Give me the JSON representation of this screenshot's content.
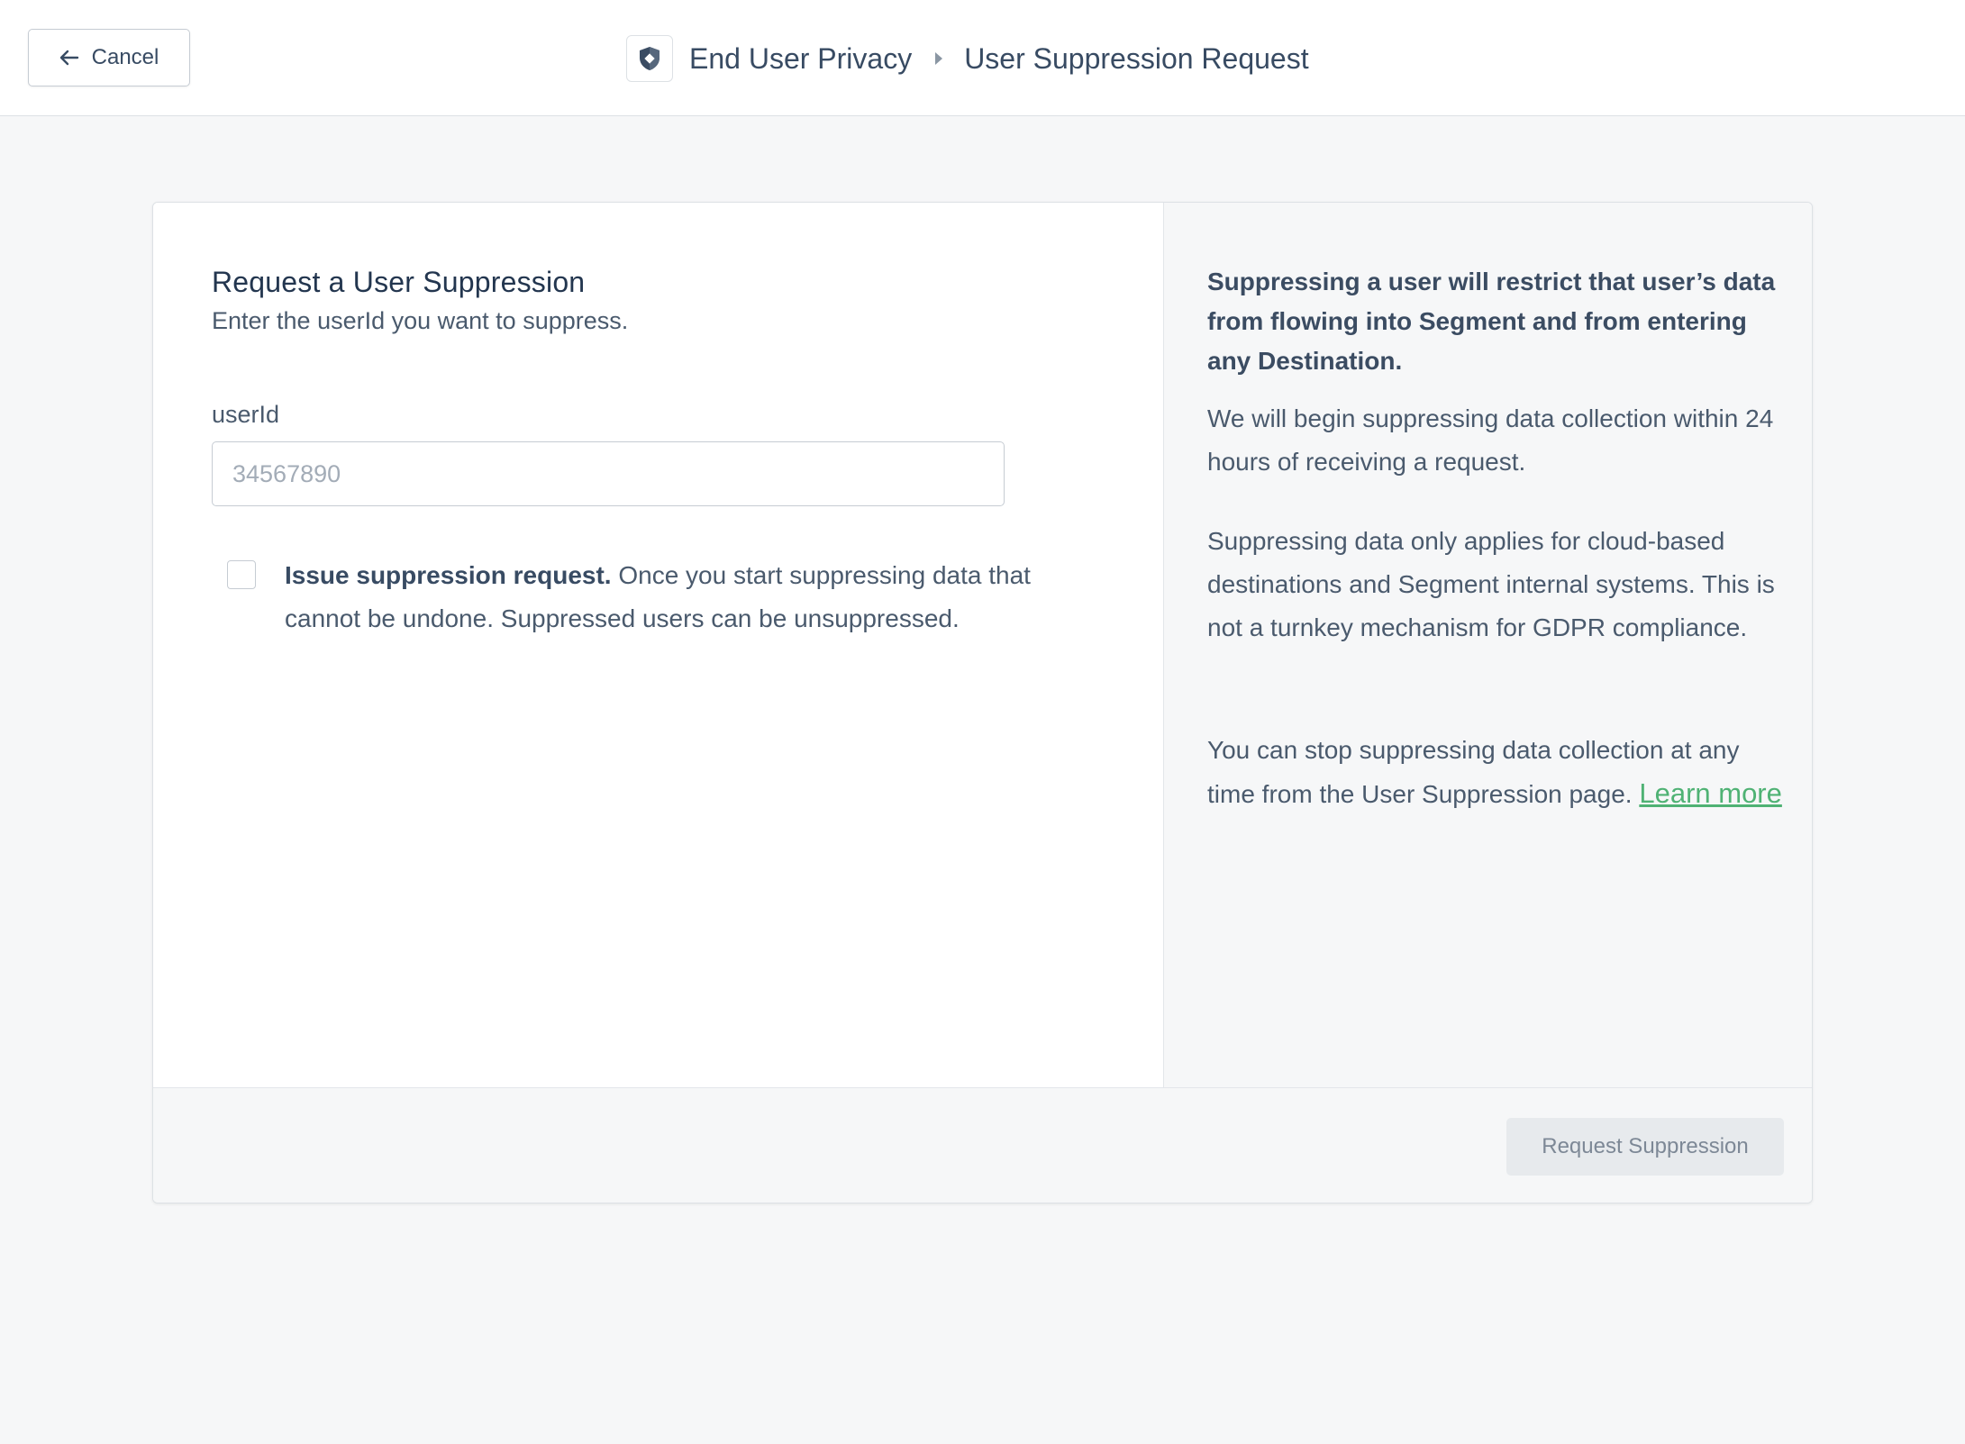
{
  "header": {
    "cancel_label": "Cancel",
    "app_icon": "shield-icon",
    "breadcrumb": {
      "parent": "End User Privacy",
      "current": "User Suppression Request"
    }
  },
  "form": {
    "title": "Request a User Suppression",
    "subtitle": "Enter the userId you want to suppress.",
    "field_label": "userId",
    "input_value": "",
    "input_placeholder": "34567890",
    "confirm_checked": false,
    "confirm_strong": "Issue suppression request.",
    "confirm_text": " Once you start suppressing data that cannot be undone. Suppressed users can be unsuppressed."
  },
  "info": {
    "p1": "Suppressing a user will restrict that user’s data from flowing into Segment and from entering any Destination.",
    "p2": "We will begin suppressing data collection within 24 hours of receiving a request.",
    "p3": "Suppressing data only applies for cloud-based destinations and Segment internal systems. This is not a turnkey mechanism for GDPR compliance.",
    "p4": "You can stop suppressing data collection at any time from the User Suppression page. ",
    "learn_more": "Learn more"
  },
  "footer": {
    "submit_label": "Request Suppression"
  },
  "colors": {
    "page_bg": "#f6f7f8",
    "text": "#3b4c62",
    "link": "#4fb274",
    "disabled_button_bg": "#e7eaed"
  }
}
